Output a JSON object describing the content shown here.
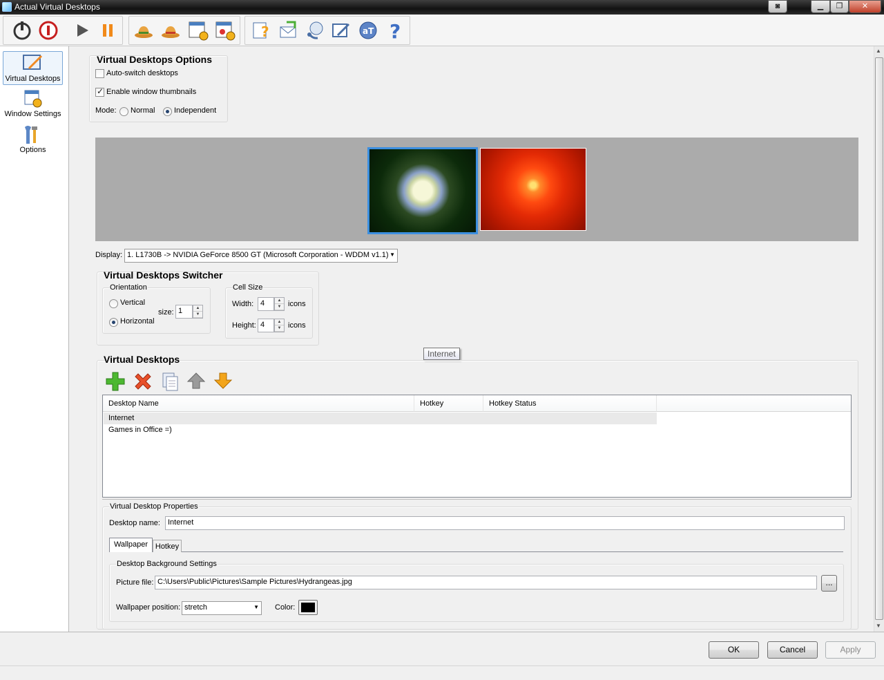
{
  "window": {
    "title": "Actual Virtual Desktops",
    "buttons": {
      "restore_extra": "◙",
      "minimize": "▁",
      "maximize": "❐",
      "close": "✕"
    }
  },
  "toolbar": {
    "icons": [
      "power-icon",
      "stop-icon",
      "play-icon",
      "pause-icon",
      "hats-icon",
      "hat-red-icon",
      "window-settings-add-icon",
      "window-settings-user-icon",
      "help-icon",
      "email-icon",
      "support-icon",
      "edit-icon",
      "logo-icon",
      "question-icon"
    ]
  },
  "nav": {
    "items": [
      {
        "label": "Virtual Desktops"
      },
      {
        "label": "Window Settings"
      },
      {
        "label": "Options"
      }
    ]
  },
  "options": {
    "heading": "Virtual Desktops Options",
    "auto_switch": "Auto-switch desktops",
    "thumbnails": "Enable window thumbnails",
    "mode_label": "Mode:",
    "mode_normal": "Normal",
    "mode_independent": "Independent"
  },
  "display": {
    "label": "Display:",
    "value": "1. L1730B  -> NVIDIA GeForce 8500 GT (Microsoft Corporation - WDDM v1.1)"
  },
  "switcher": {
    "heading": "Virtual Desktops Switcher",
    "orientation_label": "Orientation",
    "vertical": "Vertical",
    "horizontal": "Horizontal",
    "size_label": "size:",
    "size_value": "1",
    "cell_label": "Cell Size",
    "width_label": "Width:",
    "width_value": "4",
    "height_label": "Height:",
    "height_value": "4",
    "icons_unit": "icons"
  },
  "tooltip": "Internet",
  "desktops": {
    "heading": "Virtual Desktops",
    "columns": [
      "Desktop Name",
      "Hotkey",
      "Hotkey Status"
    ],
    "rows": [
      {
        "name": "Internet",
        "hotkey": "",
        "status": ""
      },
      {
        "name": "Games in Office =)",
        "hotkey": "",
        "status": ""
      }
    ]
  },
  "properties": {
    "heading": "Virtual Desktop Properties",
    "name_label": "Desktop name:",
    "name_value": "Internet",
    "tabs": [
      "Wallpaper",
      "Hotkey"
    ],
    "bg_heading": "Desktop Background Settings",
    "picture_label": "Picture file:",
    "picture_value": "C:\\Users\\Public\\Pictures\\Sample Pictures\\Hydrangeas.jpg",
    "browse": "...",
    "position_label": "Wallpaper position:",
    "position_value": "stretch",
    "color_label": "Color:",
    "color_value": "#000000"
  },
  "dialog": {
    "ok": "OK",
    "cancel": "Cancel",
    "apply": "Apply"
  }
}
